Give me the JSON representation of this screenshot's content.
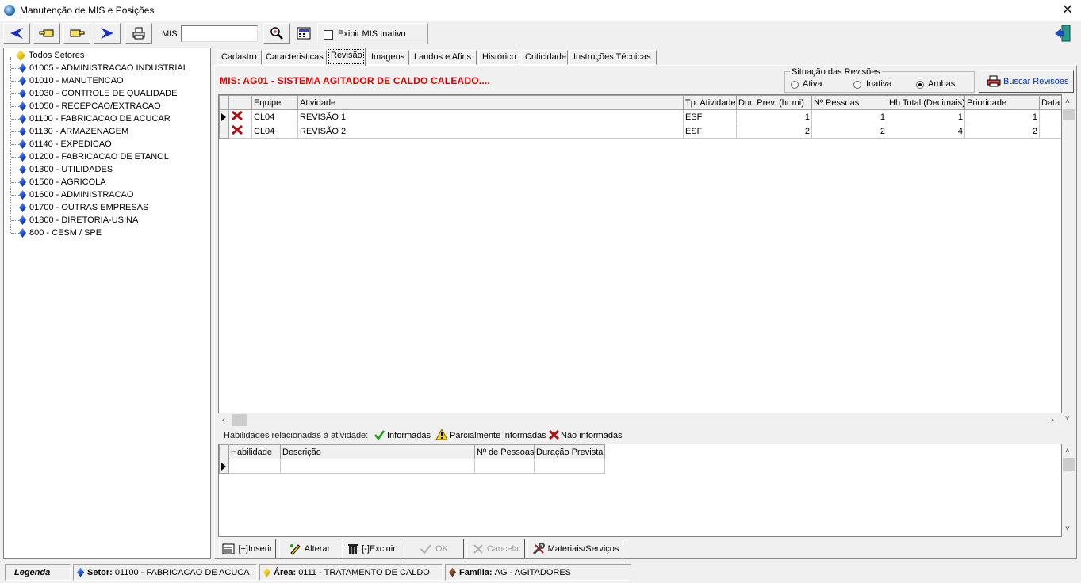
{
  "window": {
    "title": "Manutenção de MIS e Posições",
    "close_glyph": "✕"
  },
  "toolbar": {
    "mis_label": "MIS",
    "mis_value": "",
    "show_inactive_label": "Exibir MIS Inativo",
    "show_inactive_checked": false
  },
  "tree": {
    "root": "Todos Setores",
    "items": [
      "01005 - ADMINISTRACAO INDUSTRIAL",
      "01010 - MANUTENCAO",
      "01030 - CONTROLE DE QUALIDADE",
      "01050 - RECEPCAO/EXTRACAO",
      "01100 - FABRICACAO DE ACUCAR",
      "01130 - ARMAZENAGEM",
      "01140 - EXPEDICAO",
      "01200 - FABRICACAO DE ETANOL",
      "01300 - UTILIDADES",
      "01500 - AGRICOLA",
      "01600 - ADMINISTRACAO",
      "01700 - OUTRAS EMPRESAS",
      "01800 - DIRETORIA-USINA",
      "800 - CESM / SPE"
    ]
  },
  "tabs": [
    "Cadastro",
    "Caracteristicas",
    "Revisão",
    "Imagens",
    "Laudos e Afins",
    "Histórico",
    "Criticidade",
    "Instruções Técnicas"
  ],
  "active_tab": "Revisão",
  "mis_title": "MIS: AG01 - SISTEMA AGITADOR DE CALDO CALEADO....",
  "situacao": {
    "legend": "Situação das Revisões",
    "options": [
      "Ativa",
      "Inativa",
      "Ambas"
    ],
    "selected": "Ambas"
  },
  "buscar_label": "Buscar Revisões",
  "revisions": {
    "columns": [
      "Equipe",
      "Atividade",
      "Tp. Atividade",
      "Dur. Prev. (hr:mi)",
      "Nº Pessoas",
      "Hh Total (Decimais)",
      "Prioridade",
      "Data"
    ],
    "rows": [
      {
        "equipe": "CL04",
        "atividade": "REVISÃO 1",
        "tp": "ESF",
        "dur": "1",
        "pessoas": "1",
        "hh": "1",
        "prioridade": "1",
        "data": ""
      },
      {
        "equipe": "CL04",
        "atividade": "REVISÃO 2",
        "tp": "ESF",
        "dur": "2",
        "pessoas": "2",
        "hh": "4",
        "prioridade": "2",
        "data": ""
      }
    ]
  },
  "habilidades": {
    "label": "Habilidades relacionadas à atividade:",
    "legend_informadas": "Informadas",
    "legend_parcial": "Parcialmente informadas",
    "legend_nao": "Não informadas",
    "columns": [
      "Habilidade",
      "Descrição",
      "Nº de Pessoas",
      "Duração Prevista"
    ]
  },
  "buttons": {
    "inserir": "[+]Inserir",
    "alterar": "Alterar",
    "excluir": "[-]Excluir",
    "ok": "OK",
    "cancela": "Cancela",
    "materiais": "Materiais/Serviços"
  },
  "status": {
    "legenda": "Legenda",
    "setor_label": "Setor:",
    "setor_value": "01100 - FABRICACAO DE ACUCA",
    "area_label": "Área:",
    "area_value": "0111 - TRATAMENTO DE CALDO",
    "familia_label": "Família:",
    "familia_value": "AG - AGITADORES"
  },
  "colors": {
    "accent_red": "#e00000",
    "link_blue": "#0033aa",
    "tree_diamond": "#1246c8"
  }
}
